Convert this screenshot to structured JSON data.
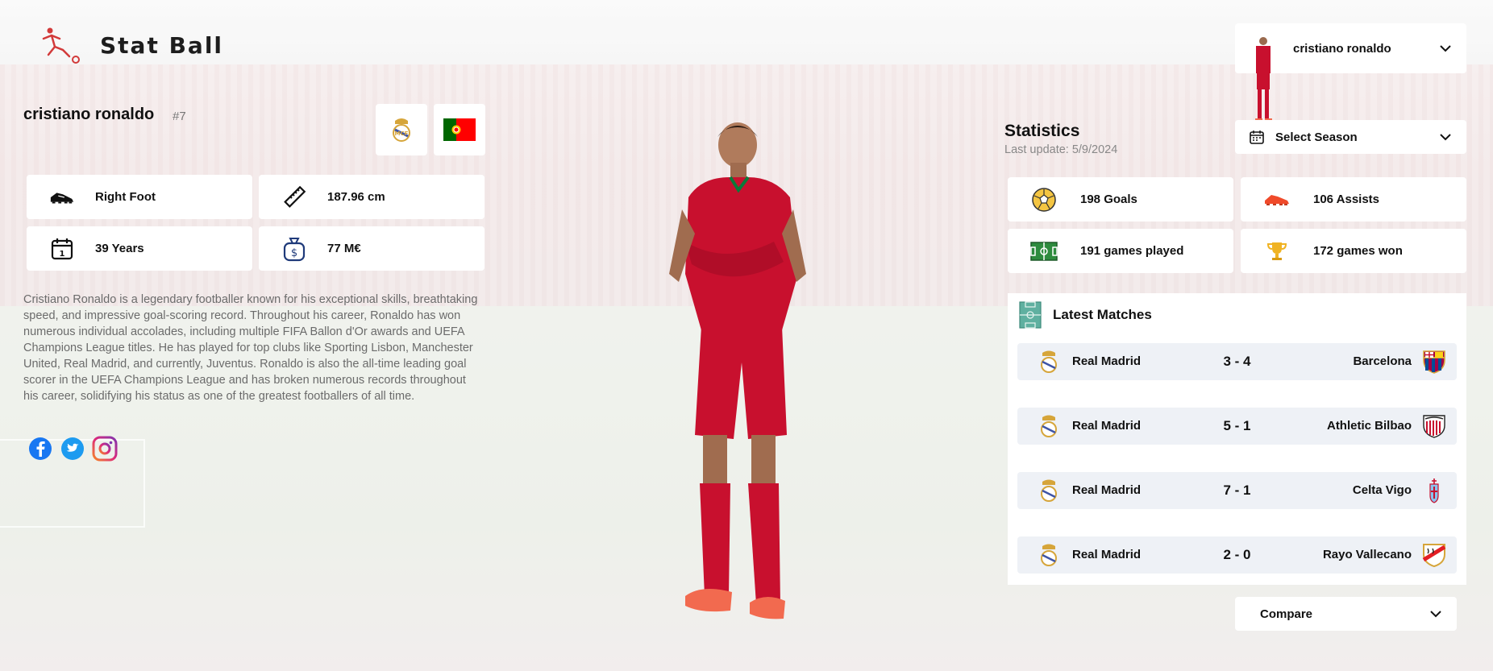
{
  "app": {
    "logo_text": "Stat Ball"
  },
  "player": {
    "name": "cristiano ronaldo",
    "number": "#7",
    "club_badge": "real-madrid-crest",
    "nation_flag": "portugal-flag",
    "info": [
      {
        "icon": "boot-icon",
        "label": "Right Foot"
      },
      {
        "icon": "ruler-icon",
        "label": "187.96 cm"
      },
      {
        "icon": "calendar-icon",
        "label": "39 Years"
      },
      {
        "icon": "money-bag-icon",
        "label": "77 M€"
      }
    ],
    "bio": "Cristiano Ronaldo is a legendary footballer known for his exceptional skills, breathtaking speed, and impressive goal-scoring record. Throughout his career, Ronaldo has won numerous individual accolades, including multiple FIFA Ballon d'Or awards and UEFA Champions League titles. He has played for top clubs like Sporting Lisbon, Manchester United, Real Madrid, and currently, Juventus. Ronaldo is also the all-time leading goal scorer in the UEFA Champions League and has broken numerous records throughout his career, solidifying his status as one of the greatest footballers of all time.",
    "socials": [
      "facebook-icon",
      "twitter-icon",
      "instagram-icon"
    ]
  },
  "player_selector": {
    "value": "cristiano ronaldo"
  },
  "statistics": {
    "title": "Statistics",
    "last_update": "Last update: 5/9/2024",
    "season_select": "Select Season",
    "cards": [
      {
        "icon": "ball-icon",
        "label": "198 Goals"
      },
      {
        "icon": "cleat-icon",
        "label": "106 Assists"
      },
      {
        "icon": "pitch-icon",
        "label": "191 games played"
      },
      {
        "icon": "trophy-icon",
        "label": "172 games won"
      }
    ]
  },
  "latest_matches": {
    "title": "Latest Matches",
    "rows": [
      {
        "home": "Real Madrid",
        "score": "3 - 4",
        "away": "Barcelona"
      },
      {
        "home": "Real Madrid",
        "score": "5 - 1",
        "away": "Athletic Bilbao"
      },
      {
        "home": "Real Madrid",
        "score": "7 - 1",
        "away": "Celta Vigo"
      },
      {
        "home": "Real Madrid",
        "score": "2 - 0",
        "away": "Rayo Vallecano"
      }
    ]
  },
  "compare": {
    "label": "Compare"
  },
  "colors": {
    "accent_red": "#c8102e",
    "card_bg": "#ffffff",
    "match_row_bg": "#eef1f6",
    "muted_text": "#6b6b6b"
  }
}
